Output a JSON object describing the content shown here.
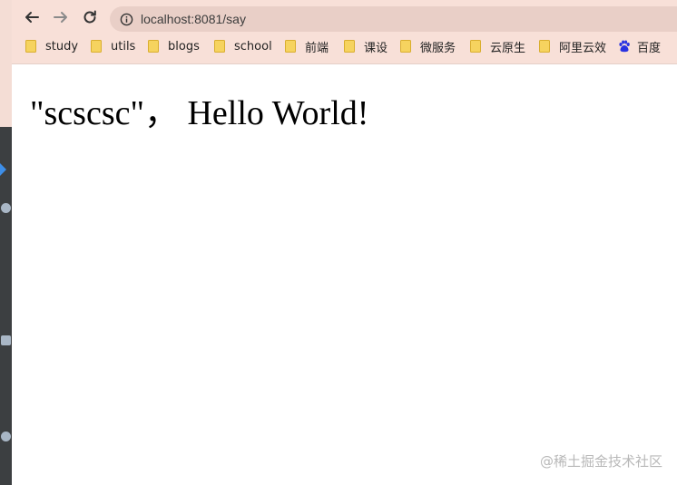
{
  "browser": {
    "url": "localhost:8081/say",
    "bookmarks": [
      {
        "label": "study",
        "icon": "folder-icon"
      },
      {
        "label": "utils",
        "icon": "folder-icon"
      },
      {
        "label": "blogs",
        "icon": "folder-icon"
      },
      {
        "label": "school",
        "icon": "folder-icon"
      },
      {
        "label": "前端",
        "icon": "folder-icon"
      },
      {
        "label": "课设",
        "icon": "folder-icon"
      },
      {
        "label": "微服务",
        "icon": "folder-icon"
      },
      {
        "label": "云原生",
        "icon": "folder-icon"
      },
      {
        "label": "阿里云效",
        "icon": "folder-icon"
      },
      {
        "label": "百度",
        "icon": "baidu-icon"
      }
    ]
  },
  "page": {
    "greeting": "\"scscsc\"， Hello World!"
  },
  "watermark": "@稀土掘金技术社区",
  "colors": {
    "chrome_bg": "#f8e0d8",
    "omnibox_bg": "#e9cfc7",
    "ide_bg": "#3c3f41",
    "folder": "#f6d35f",
    "baidu_blue": "#2932e1"
  }
}
